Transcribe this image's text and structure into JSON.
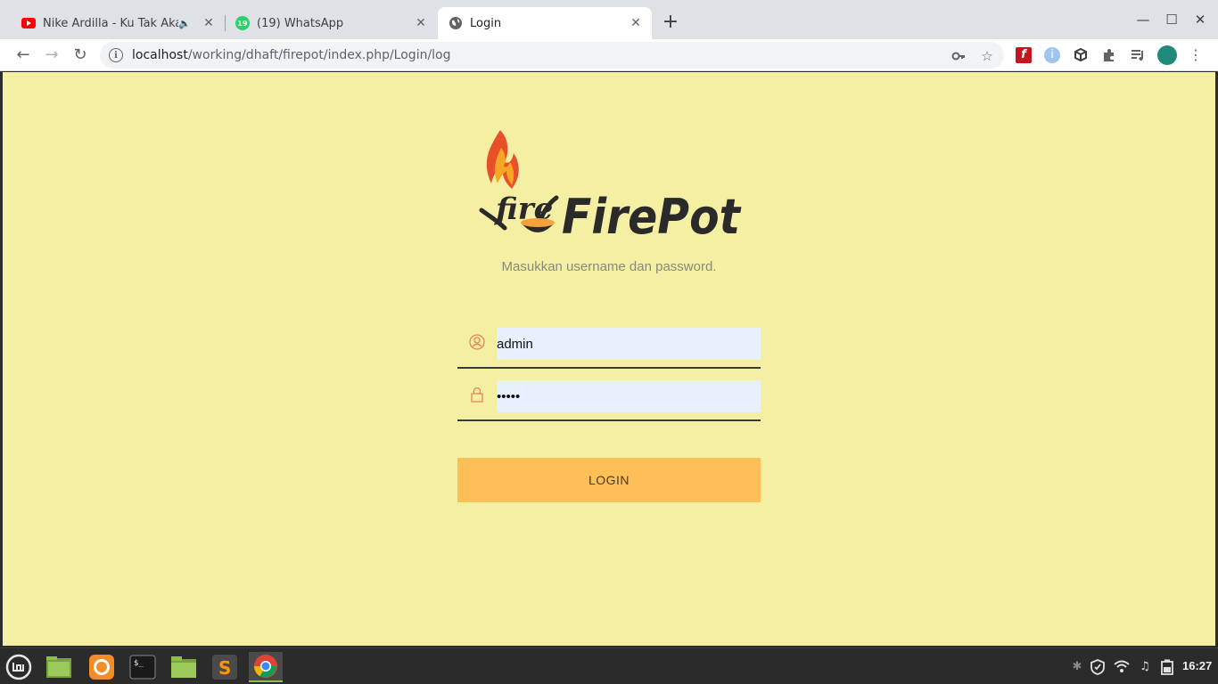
{
  "browser": {
    "tabs": [
      {
        "title": "Nike Ardilla - Ku Tak Akan",
        "favicon": "youtube-icon",
        "audio": true,
        "active": false
      },
      {
        "title": "(19) WhatsApp",
        "favicon": "whatsapp-icon",
        "badge": "19",
        "active": false
      },
      {
        "title": "Login",
        "favicon": "globe-icon",
        "active": true
      }
    ],
    "url_host": "localhost",
    "url_path": "/working/dhaft/firepot/index.php/Login/log"
  },
  "page": {
    "logo_text": "FirePot",
    "logo_mark_text": "fire",
    "logo_mark_sub": "POT",
    "subtitle": "Masukkan username dan password.",
    "username_value": "admin",
    "password_value": "•••••",
    "login_label": "LOGIN",
    "colors": {
      "background": "#f5efa4",
      "button": "#ffbf57",
      "input_fill": "#e8effd",
      "icon_accent": "#e8835a"
    }
  },
  "taskbar": {
    "clock": "16:27",
    "launchers": [
      "mint-menu-icon",
      "files-icon",
      "firefox-icon",
      "terminal-icon",
      "folder-icon",
      "sublime-icon",
      "chrome-icon"
    ]
  }
}
